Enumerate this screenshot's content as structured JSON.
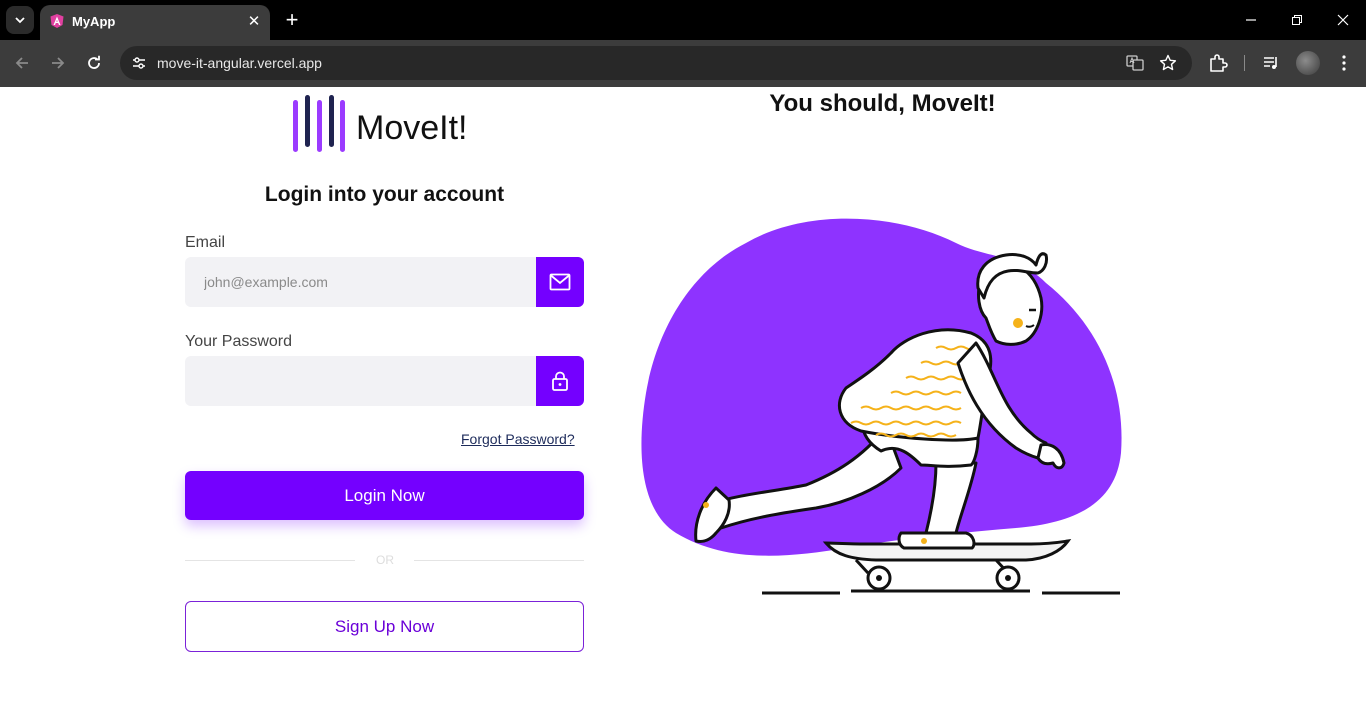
{
  "browser": {
    "tab_title": "MyApp",
    "url": "move-it-angular.vercel.app"
  },
  "brand": {
    "name": "MoveIt!",
    "primary_color": "#7400ff",
    "blob_color": "#8e33ff"
  },
  "login": {
    "title": "Login into your account",
    "email_label": "Email",
    "email_placeholder": "john@example.com",
    "password_label": "Your Password",
    "password_placeholder": "",
    "forgot_link": "Forgot Password?",
    "login_button": "Login Now",
    "divider_text": "OR",
    "signup_button": "Sign Up Now"
  },
  "hero": {
    "headline": "You should, MoveIt!",
    "illustration": "skateboarder-illustration"
  }
}
